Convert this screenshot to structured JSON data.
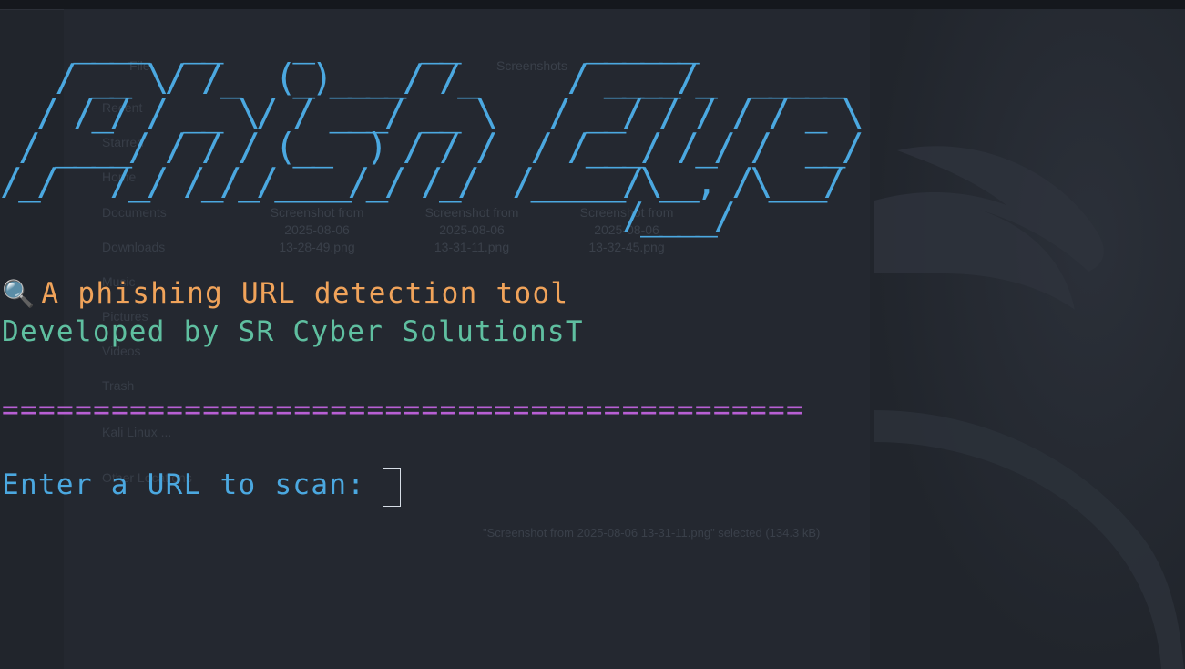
{
  "terminal": {
    "banner_ascii": "    ____  __    _      __       ______\n   / __ \\/ /_  (_)____/ /_     / ____/_  _____\n  / /_/ / __ \\/ / ___/ __ \\   / __/ / / / / _ \\\n / ____/ / / / (__  ) / / /  / /___/ /_/ /  __/\n/_/   /_/ /_/_/____/_/ /_/  /_____/\\__, /\\___/\n                                  /____/",
    "search_icon": "🔍",
    "tagline": "A phishing URL detection tool",
    "developer": "Developed by SR Cyber SolutionsT",
    "separator": "============================================",
    "prompt": "Enter a URL to scan: ",
    "input_value": ""
  },
  "background_file_manager": {
    "title": "File",
    "location": "Screenshots",
    "sidebar": [
      "Recent",
      "Starred",
      "Home",
      "Documents",
      "Downloads",
      "Music",
      "Pictures",
      "Videos",
      "Trash",
      "Kali Linux ...",
      "Other Locations"
    ],
    "files": [
      {
        "name": "Screenshot from\n2025-08-06\n13-28-49.png"
      },
      {
        "name": "Screenshot from\n2025-08-06\n13-31-11.png"
      },
      {
        "name": "Screenshot from\n2025-08-06\n13-32-45.png"
      }
    ],
    "status": "\"Screenshot from 2025-08-06 13-31-11.png\" selected (134.3 kB)"
  },
  "colors": {
    "background": "#21252c",
    "banner": "#4ba8e0",
    "tagline": "#f0a35a",
    "developer": "#5fbfa0",
    "separator": "#b85fd4",
    "prompt": "#4ba8e0"
  }
}
